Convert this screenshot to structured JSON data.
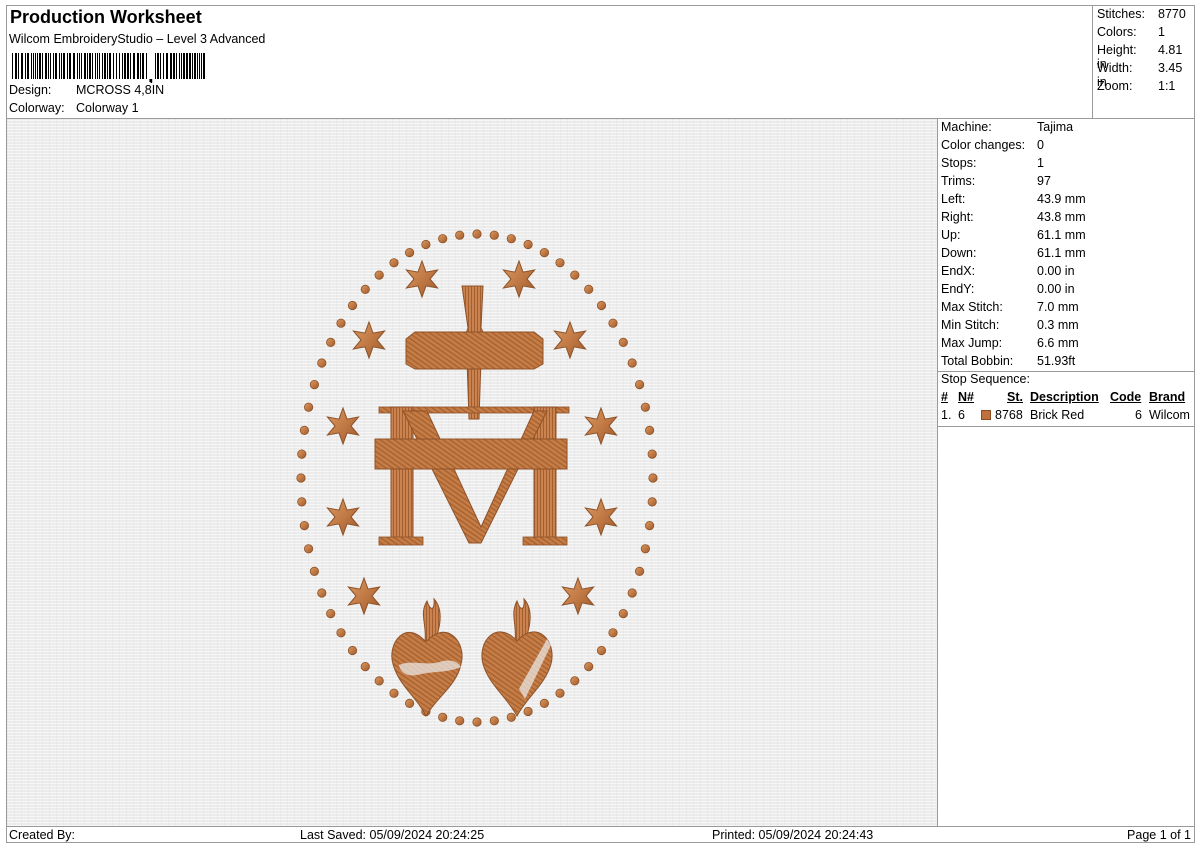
{
  "header": {
    "title": "Production Worksheet",
    "subtitle": "Wilcom EmbroideryStudio – Level 3 Advanced",
    "design_label": "Design:",
    "design_value": "MCROSS 4,8IN",
    "colorway_label": "Colorway:",
    "colorway_value": "Colorway 1"
  },
  "summary": {
    "stitches_label": "Stitches:",
    "stitches": "8770",
    "colors_label": "Colors:",
    "colors": "1",
    "height_label": "Height:",
    "height": "4.81 in",
    "width_label": "Width:",
    "width": "3.45 in",
    "zoom_label": "Zoom:",
    "zoom": "1:1"
  },
  "details": {
    "machine_label": "Machine:",
    "machine": "Tajima",
    "color_changes_label": "Color changes:",
    "color_changes": "0",
    "stops_label": "Stops:",
    "stops": "1",
    "trims_label": "Trims:",
    "trims": "97",
    "left_label": "Left:",
    "left": "43.9 mm",
    "right_label": "Right:",
    "right": "43.8 mm",
    "up_label": "Up:",
    "up": "61.1 mm",
    "down_label": "Down:",
    "down": "61.1 mm",
    "endx_label": "EndX:",
    "endx": "0.00 in",
    "endy_label": "EndY:",
    "endy": "0.00 in",
    "max_stitch_label": "Max Stitch:",
    "max_stitch": "7.0 mm",
    "min_stitch_label": "Min Stitch:",
    "min_stitch": "0.3 mm",
    "max_jump_label": "Max Jump:",
    "max_jump": "6.6 mm",
    "total_bobbin_label": "Total Bobbin:",
    "total_bobbin": "51.93ft"
  },
  "stop_sequence": {
    "title": "Stop Sequence:",
    "headers": {
      "num": "#",
      "n": "N#",
      "st": "St.",
      "description": "Description",
      "code": "Code",
      "brand": "Brand"
    },
    "rows": [
      {
        "num": "1.",
        "n": "6",
        "st": "8768",
        "description": "Brick Red",
        "code": "6",
        "brand": "Wilcom",
        "color": "#c0703c"
      }
    ]
  },
  "footer": {
    "created_by": "Created By:",
    "last_saved": "Last Saved: 05/09/2024 20:24:25",
    "printed": "Printed: 05/09/2024 20:24:43",
    "page": "Page 1 of 1"
  },
  "design_preview": {
    "thread_color": "#c27a45",
    "thread_shadow": "#8e5228",
    "fabric_color": "#ececec"
  }
}
